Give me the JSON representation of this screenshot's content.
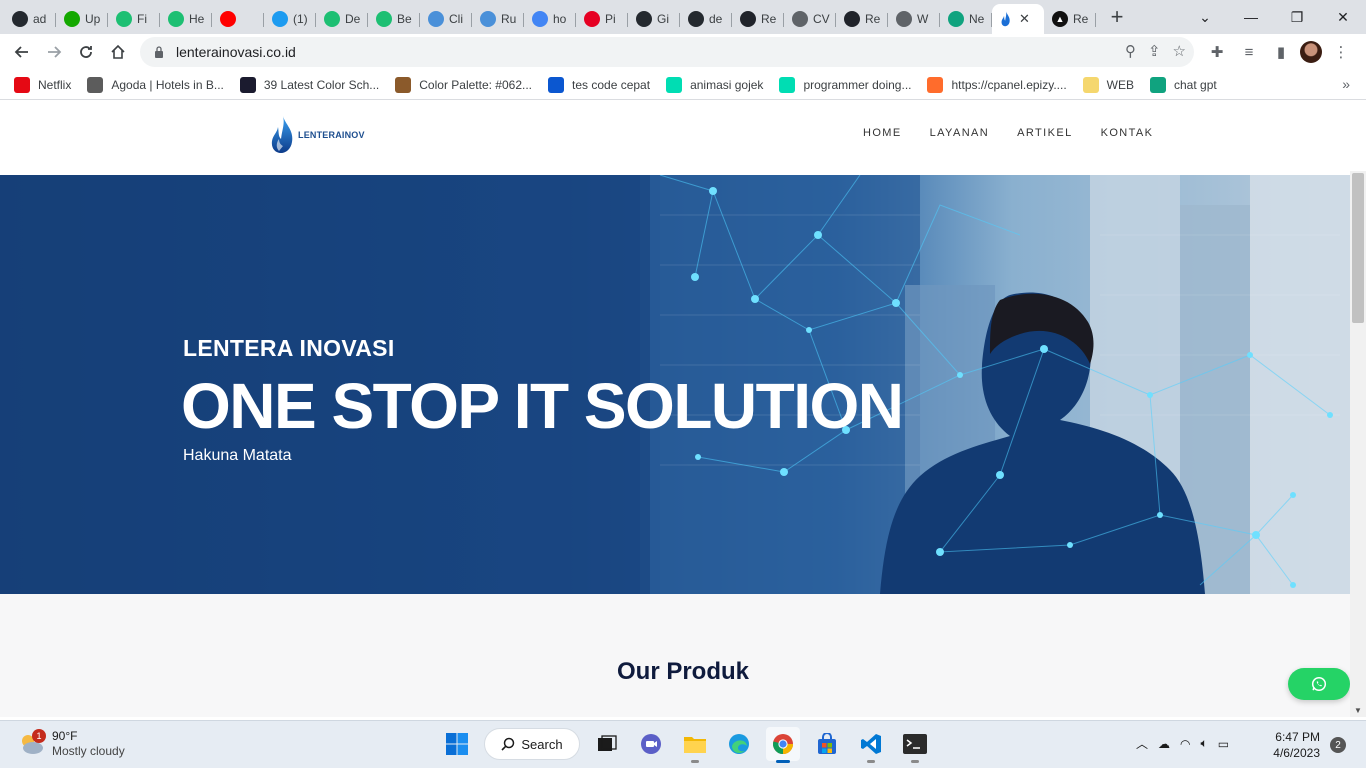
{
  "browser": {
    "tabs": [
      {
        "label": "ad",
        "icon": "github-icon",
        "color": "#24292f"
      },
      {
        "label": "Up",
        "icon": "upwork-icon",
        "color": "#14a800"
      },
      {
        "label": "Fi",
        "icon": "fiverr-icon",
        "color": "#1dbf73"
      },
      {
        "label": "He",
        "icon": "fiverr-icon",
        "color": "#1dbf73"
      },
      {
        "label": "",
        "icon": "youtube-icon",
        "color": "#ff0000"
      },
      {
        "label": "(1)",
        "icon": "twitter-icon",
        "color": "#1d9bf0"
      },
      {
        "label": "De",
        "icon": "fiverr-icon",
        "color": "#1dbf73"
      },
      {
        "label": "Be",
        "icon": "fiverr-icon",
        "color": "#1dbf73"
      },
      {
        "label": "Cli",
        "icon": "house-icon",
        "color": "#4a90d9"
      },
      {
        "label": "Ru",
        "icon": "house-icon",
        "color": "#4a90d9"
      },
      {
        "label": "ho",
        "icon": "google-icon",
        "color": "#4285f4"
      },
      {
        "label": "Pi",
        "icon": "pinterest-icon",
        "color": "#e60023"
      },
      {
        "label": "Gi",
        "icon": "github-icon",
        "color": "#24292f"
      },
      {
        "label": "de",
        "icon": "github-icon",
        "color": "#24292f"
      },
      {
        "label": "Re",
        "icon": "react-icon",
        "color": "#20232a"
      },
      {
        "label": "CV",
        "icon": "globe-icon",
        "color": "#5f6368"
      },
      {
        "label": "Re",
        "icon": "react-icon",
        "color": "#20232a"
      },
      {
        "label": "W",
        "icon": "globe-icon",
        "color": "#5f6368"
      },
      {
        "label": "Ne",
        "icon": "chatgpt-icon",
        "color": "#10a37f"
      }
    ],
    "active_tab": {
      "label": "",
      "icon": "lenterainov-flame-icon",
      "close": "✕"
    },
    "last_tab": {
      "label": "Re",
      "icon": "arrow-icon",
      "color": "#111111"
    },
    "new_tab": "+",
    "url": "lenterainovasi.co.id",
    "bookmarks": [
      {
        "label": "Netflix",
        "icon": "netflix-icon",
        "color": "#e50914"
      },
      {
        "label": "Agoda | Hotels in B...",
        "icon": "agoda-icon",
        "color": "#5c5c5c"
      },
      {
        "label": "39 Latest Color Sch...",
        "icon": "color-scheme-icon",
        "color": "#1b1b2f"
      },
      {
        "label": "Color Palette: #062...",
        "icon": "palette-icon",
        "color": "#8b5a2b"
      },
      {
        "label": "tes code cepat",
        "icon": "speed-s-icon",
        "color": "#0b57d0"
      },
      {
        "label": "animasi gojek",
        "icon": "lottie-icon",
        "color": "#00ddb3"
      },
      {
        "label": "programmer doing...",
        "icon": "lottie-icon",
        "color": "#00ddb3"
      },
      {
        "label": "https://cpanel.epizy....",
        "icon": "cpanel-icon",
        "color": "#ff6c2c"
      },
      {
        "label": "WEB",
        "icon": "folder-icon",
        "color": "#f5d76e"
      },
      {
        "label": "chat gpt",
        "icon": "chatgpt-icon",
        "color": "#10a37f"
      }
    ],
    "bookmarks_more": "»"
  },
  "site": {
    "logo_text": "LENTERAINOV",
    "menu": [
      "HOME",
      "LAYANAN",
      "ARTIKEL",
      "KONTAK"
    ],
    "hero": {
      "kicker": "LENTERA INOVASI",
      "headline": "ONE STOP IT SOLUTION",
      "tagline": "Hakuna Matata"
    },
    "section_title": "Our Produk",
    "colors": {
      "accent": "#1d4e8f",
      "whatsapp": "#25d366",
      "heading": "#0f1b3d"
    }
  },
  "taskbar": {
    "weather": {
      "temp": "90°F",
      "condition": "Mostly cloudy",
      "badge": "1"
    },
    "search_label": "Search",
    "time": "6:47 PM",
    "date": "4/6/2023",
    "notifications": "2"
  }
}
